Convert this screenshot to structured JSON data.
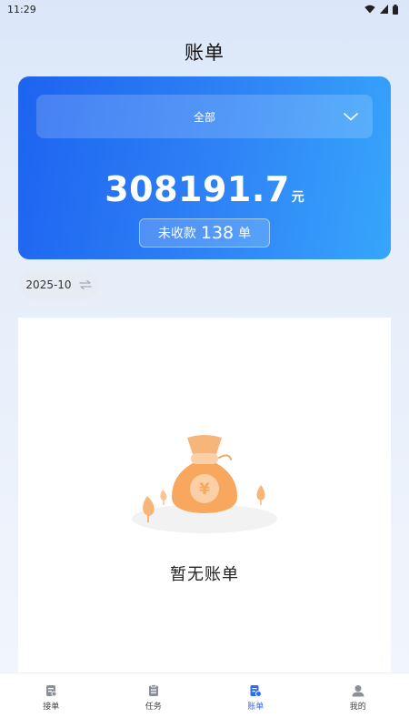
{
  "status_bar": {
    "time": "11:29"
  },
  "header": {
    "title": "账单"
  },
  "summary": {
    "filter_label": "全部",
    "total_amount": "308191.7",
    "currency_unit": "元",
    "unpaid_label": "未收款",
    "unpaid_count": "138",
    "unpaid_unit": "单"
  },
  "date_filter": {
    "value": "2025-10"
  },
  "empty_state": {
    "text": "暂无账单"
  },
  "bottom_nav": {
    "items": [
      {
        "label": "接单",
        "icon": "clipboard-icon",
        "active": false
      },
      {
        "label": "任务",
        "icon": "task-icon",
        "active": false
      },
      {
        "label": "账单",
        "icon": "bill-icon",
        "active": true
      },
      {
        "label": "我的",
        "icon": "user-icon",
        "active": false
      }
    ]
  },
  "colors": {
    "accent": "#2f6df0",
    "card_gradient_start": "#1d63f0",
    "card_gradient_end": "#36a6fb",
    "illustration_orange": "#f7a85e"
  }
}
